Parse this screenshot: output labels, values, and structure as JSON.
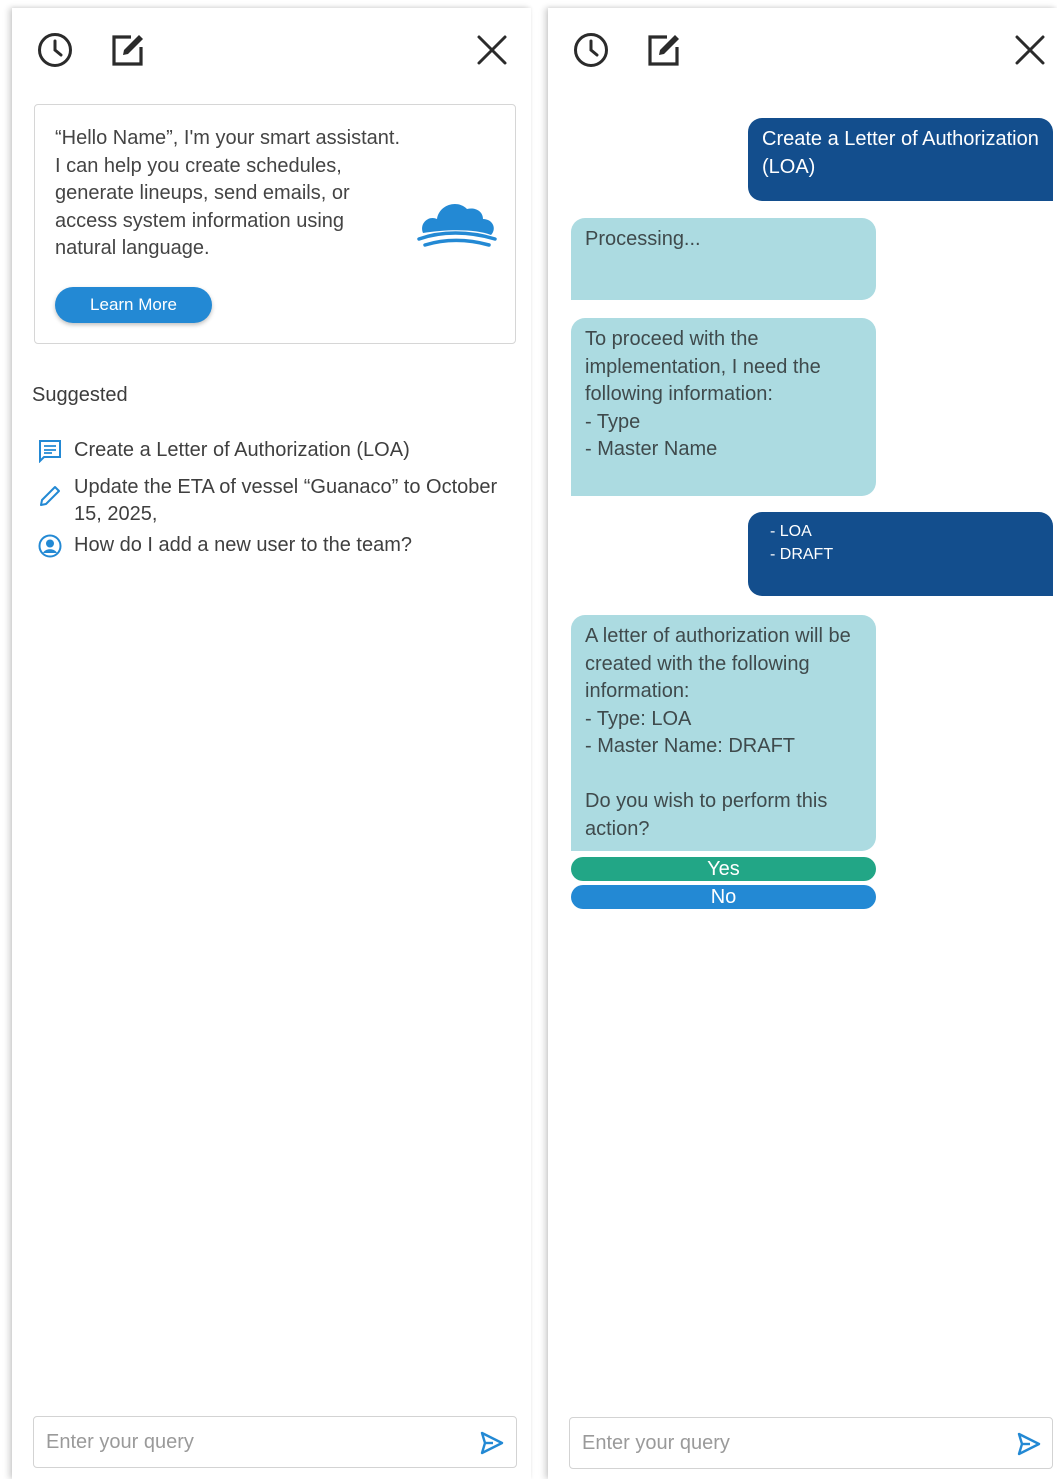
{
  "colors": {
    "accent_blue": "#2389d4",
    "user_bubble": "#134e8d",
    "bot_bubble": "#acdbe1",
    "yes_green": "#22a686",
    "icon_dark": "#2b2b2b"
  },
  "left_panel": {
    "header": {
      "icons": [
        "history-icon",
        "compose-icon",
        "close-icon"
      ]
    },
    "intro": {
      "text": "“Hello Name”, I'm your smart assistant. I can help you create schedules, generate lineups, send emails, or access system information using natural language.",
      "learn_more_label": "Learn More",
      "logo_icon": "cloud-logo-icon"
    },
    "suggested": {
      "title": "Suggested",
      "items": [
        {
          "icon": "message-icon",
          "text": "Create a Letter of Authorization (LOA)"
        },
        {
          "icon": "pencil-icon",
          "text": "Update the ETA of vessel “Guanaco” to October 15, 2025,"
        },
        {
          "icon": "user-circle-icon",
          "text": "How do I add a new user to the team?"
        }
      ]
    },
    "query": {
      "placeholder": "Enter your query",
      "send_icon": "send-icon"
    }
  },
  "right_panel": {
    "header": {
      "icons": [
        "history-icon",
        "compose-icon",
        "close-icon"
      ]
    },
    "messages": [
      {
        "from": "user",
        "text": "Create a Letter of Authorization (LOA)"
      },
      {
        "from": "bot",
        "text": "Processing..."
      },
      {
        "from": "bot",
        "text": "To proceed with the implementation, I need the following information:\n- Type\n- Master Name"
      },
      {
        "from": "user",
        "text": "- LOA\n- DRAFT"
      },
      {
        "from": "bot",
        "text": "A letter of authorization will be created with the following information:\n- Type: LOA\n- Master Name: DRAFT\n\nDo you wish to perform this action?"
      }
    ],
    "actions": {
      "yes_label": "Yes",
      "no_label": "No"
    },
    "query": {
      "placeholder": "Enter your query",
      "send_icon": "send-icon"
    }
  }
}
